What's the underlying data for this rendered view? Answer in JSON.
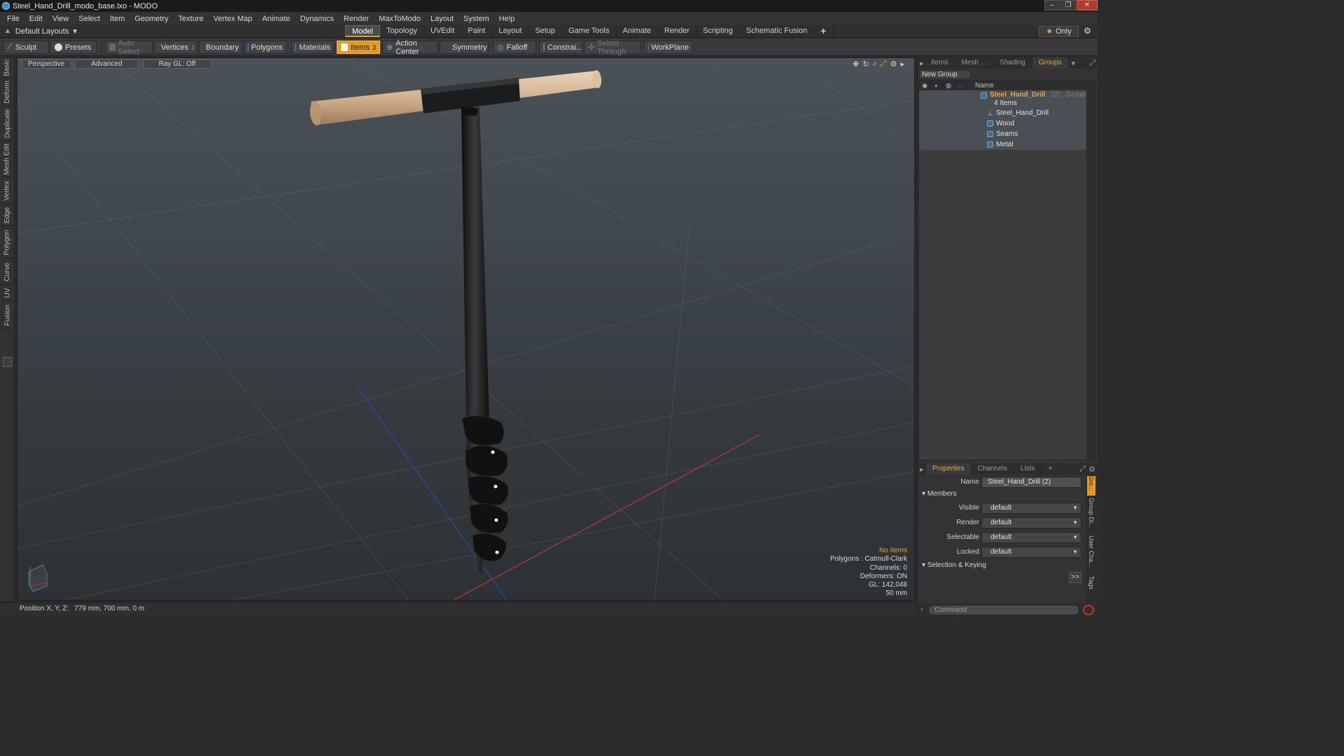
{
  "window": {
    "title": "Steel_Hand_Drill_modo_base.lxo - MODO",
    "controls": [
      "–",
      "❐",
      "✕"
    ]
  },
  "menu": [
    "File",
    "Edit",
    "View",
    "Select",
    "Item",
    "Geometry",
    "Texture",
    "Vertex Map",
    "Animate",
    "Dynamics",
    "Render",
    "MaxToModo",
    "Layout",
    "System",
    "Help"
  ],
  "layout": {
    "dropdown": "Default Layouts",
    "tabs": [
      "Model",
      "Topology",
      "UVEdit",
      "Paint",
      "Layout",
      "Setup",
      "Game Tools",
      "Animate",
      "Render",
      "Scripting",
      "Schematic Fusion"
    ],
    "active_tab": "Model",
    "add": "+",
    "only_button": "Only"
  },
  "toolbar": {
    "sculpt": "Sculpt",
    "presets": "Presets",
    "auto_select": "Auto Select",
    "vertices": "Vertices",
    "vertices_count": "1",
    "boundary": "Boundary",
    "polygons": "Polygons",
    "materials": "Materials",
    "items": "Items",
    "items_count": "3",
    "action_center": "Action Center",
    "symmetry": "Symmetry",
    "falloff": "Falloff",
    "constraints": "Constrai...",
    "select_through": "Select Through",
    "workplane": "WorkPlane"
  },
  "left_tabs": [
    "Basic",
    "Deform",
    "Duplicate",
    "Mesh Edit",
    "Vertex",
    "Edge",
    "Polygon",
    "Curve",
    "UV",
    "Fusion"
  ],
  "viewport": {
    "view": "Perspective",
    "shading": "Advanced",
    "raygl": "Ray GL: Off",
    "info": {
      "items": "No Items",
      "polygons": "Polygons : Catmull-Clark",
      "channels": "Channels: 0",
      "deformers": "Deformers: ON",
      "gl": "GL: 142,048",
      "scale": "50 mm"
    }
  },
  "status": {
    "label": "Position X, Y, Z:",
    "value": "779 mm, 700 mm, 0 m"
  },
  "right_panel": {
    "tabs": [
      "Items",
      "Mesh ...",
      "Shading",
      "Groups"
    ],
    "active_tab": "Groups",
    "new_group": "New Group",
    "column_name": "Name",
    "group": {
      "name": "Steel_Hand_Drill",
      "suffix": "(2) : Group",
      "count": "4 Items",
      "members": [
        "Steel_Hand_Drill",
        "Wood",
        "Seams",
        "Metal"
      ]
    }
  },
  "properties": {
    "tabs": [
      "Properties",
      "Channels",
      "Lists"
    ],
    "active_tab": "Properties",
    "add": "+",
    "name_label": "Name",
    "name_value": "Steel_Hand_Drill (2)",
    "members_section": "Members",
    "fields": [
      {
        "label": "Visible",
        "value": "default"
      },
      {
        "label": "Render",
        "value": "default"
      },
      {
        "label": "Selectable",
        "value": "default"
      },
      {
        "label": "Locked",
        "value": "default"
      }
    ],
    "keying_section": "Selection & Keying",
    "expand": ">>",
    "side_tabs": [
      "Gro...",
      "Group Di...",
      "User Cha...",
      "Tags"
    ],
    "command_placeholder": "Command"
  },
  "colors": {
    "accent": "#e39a2a",
    "highlight_text": "#f1a23a",
    "background": "#2b2b2b"
  }
}
